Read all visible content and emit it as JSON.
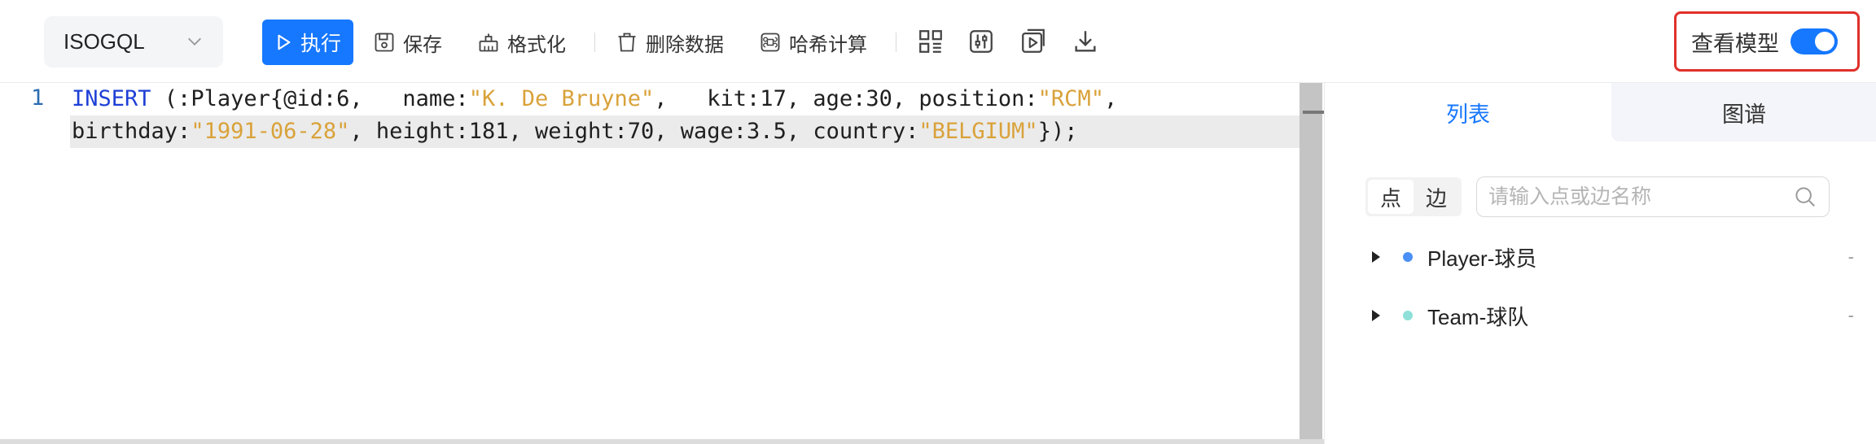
{
  "toolbar": {
    "language": "ISOGQL",
    "run_label": "执行",
    "save_label": "保存",
    "format_label": "格式化",
    "delete_label": "删除数据",
    "hash_label": "哈希计算",
    "model_label": "查看模型",
    "model_toggle_on": true
  },
  "editor": {
    "line_number": "1",
    "line1": {
      "keyword": "INSERT",
      "t1": " (:Player{@id:6,   name:",
      "s1": "\"K. De Bruyne\"",
      "t2": ",   kit:17, age:30, position:",
      "s2": "\"RCM\"",
      "t3": ","
    },
    "line2": {
      "t1": "birthday:",
      "s1": "\"1991-06-28\"",
      "t2": ", height:181, weight:70, wage:3.5, country:",
      "s2": "\"BELGIUM\"",
      "t3": "});"
    }
  },
  "panel": {
    "tabs": [
      {
        "label": "列表",
        "active": true
      },
      {
        "label": "图谱",
        "active": false
      }
    ],
    "segment": {
      "vertex": "点",
      "edge": "边",
      "selected": "点"
    },
    "search": {
      "placeholder": "请输入点或边名称",
      "value": ""
    },
    "items": [
      {
        "label": "Player-球员",
        "color": "#4a8ff5",
        "tail": "-"
      },
      {
        "label": "Team-球队",
        "color": "#8ee0d8",
        "tail": "-"
      }
    ]
  },
  "colors": {
    "accent": "#1677ff",
    "keyword": "#1d3fd6",
    "string": "#d9a23a",
    "highlight_border": "#e0302a"
  }
}
